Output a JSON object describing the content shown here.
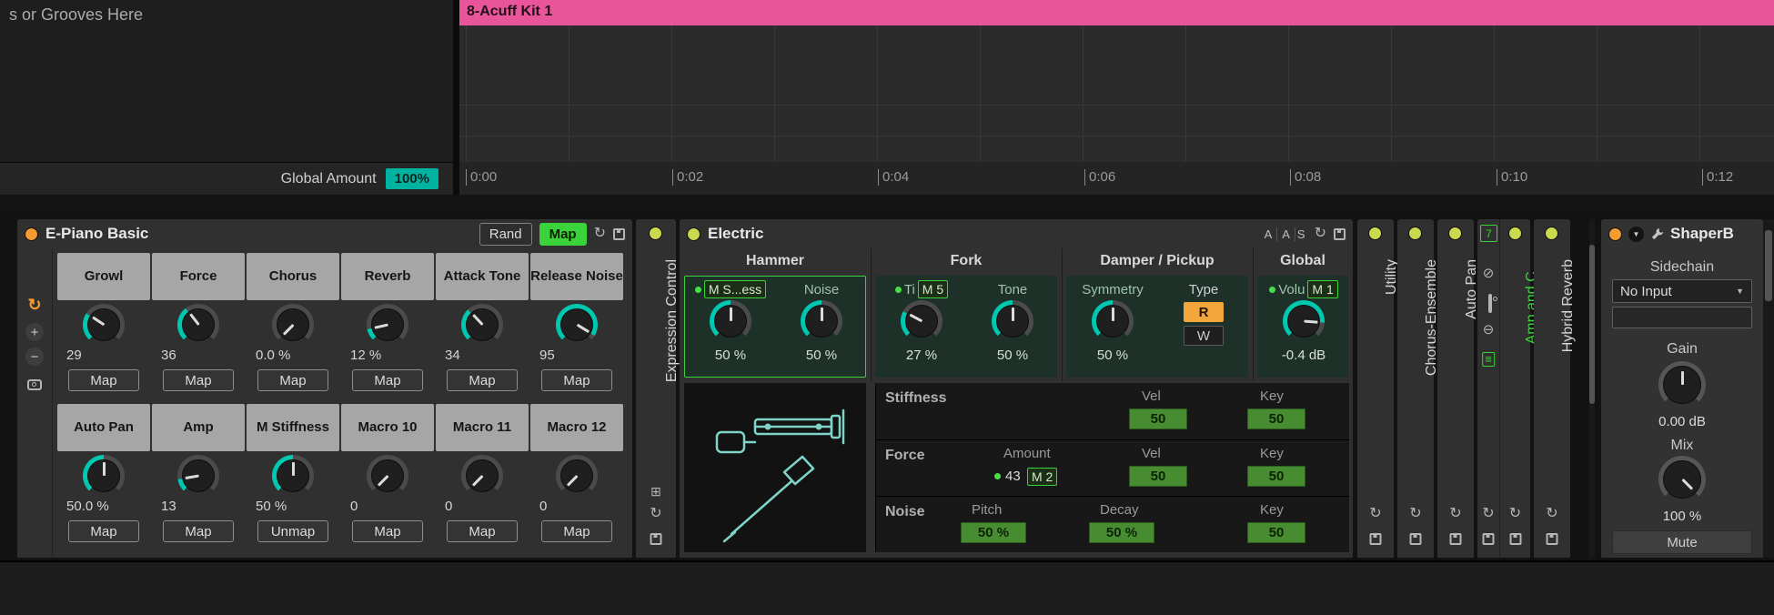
{
  "colors": {
    "teal": "#00c7b0",
    "green": "#3ad43a",
    "orange": "#f59b31",
    "pink": "#e9559b",
    "badge_teal": "#00b3a0"
  },
  "top": {
    "hint": "s or Grooves Here",
    "global_amount_label": "Global Amount",
    "global_amount_value": "100%",
    "clip_name": "8-Acuff Kit 1",
    "ticks": [
      "0:00",
      "0:02",
      "0:04",
      "0:06",
      "0:08",
      "0:10",
      "0:12"
    ]
  },
  "epiano": {
    "title": "E-Piano Basic",
    "rand": "Rand",
    "map": "Map",
    "row1": [
      {
        "name": "Growl",
        "value": "29",
        "pct": 29,
        "btn": "Map"
      },
      {
        "name": "Force",
        "value": "36",
        "pct": 36,
        "btn": "Map"
      },
      {
        "name": "Chorus",
        "value": "0.0 %",
        "pct": 0,
        "btn": "Map"
      },
      {
        "name": "Reverb",
        "value": "12 %",
        "pct": 12,
        "btn": "Map"
      },
      {
        "name": "Attack Tone",
        "value": "34",
        "pct": 34,
        "btn": "Map"
      },
      {
        "name": "Release Noise",
        "value": "95",
        "pct": 95,
        "btn": "Map"
      }
    ],
    "row2": [
      {
        "name": "Auto Pan",
        "value": "50.0 %",
        "pct": 50,
        "btn": "Map"
      },
      {
        "name": "Amp",
        "value": "13",
        "pct": 13,
        "btn": "Map"
      },
      {
        "name": "M Stiffness",
        "value": "50 %",
        "pct": 50,
        "btn": "Unmap"
      },
      {
        "name": "Macro 10",
        "value": "0",
        "pct": 0,
        "btn": "Map"
      },
      {
        "name": "Macro 11",
        "value": "0",
        "pct": 0,
        "btn": "Map"
      },
      {
        "name": "Macro 12",
        "value": "0",
        "pct": 0,
        "btn": "Map"
      }
    ]
  },
  "expression": {
    "title": "Expression Control"
  },
  "electric": {
    "title": "Electric",
    "brand": [
      "A",
      "A",
      "S"
    ],
    "sections": {
      "hammer": "Hammer",
      "fork": "Fork",
      "damper": "Damper / Pickup",
      "global": "Global"
    },
    "hammer": {
      "p1_label": "M S...ess",
      "p1_value": "50 %",
      "p1_pct": 50,
      "p2_label": "Noise",
      "p2_value": "50 %",
      "p2_pct": 50
    },
    "fork": {
      "p1_label": "Ti",
      "p1_box": "M 5",
      "p1_value": "27 %",
      "p1_pct": 27,
      "p2_label": "Tone",
      "p2_value": "50 %",
      "p2_pct": 50
    },
    "damper": {
      "p1_label": "Symmetry",
      "p1_value": "50 %",
      "p1_pct": 50,
      "type_label": "Type",
      "r": "R",
      "w": "W"
    },
    "global": {
      "label": "Volu",
      "box": "M 1",
      "value": "-0.4 dB",
      "pct": 85
    },
    "table": {
      "stiffness": {
        "name": "Stiffness",
        "vel_h": "Vel",
        "vel": "50",
        "key_h": "Key",
        "key": "50"
      },
      "force": {
        "name": "Force",
        "amount_h": "Amount",
        "amount": "43",
        "amount_box": "M 2",
        "vel_h": "Vel",
        "vel": "50",
        "key_h": "Key",
        "key": "50"
      },
      "noise": {
        "name": "Noise",
        "pitch_h": "Pitch",
        "pitch": "50 %",
        "decay_h": "Decay",
        "decay": "50 %",
        "key_h": "Key",
        "key": "50"
      }
    }
  },
  "collapsed": {
    "utility": "Utility",
    "chorus": "Chorus-Ensemble",
    "autopan": "Auto Pan",
    "amp": "Amp and C...",
    "amp_badge": "7",
    "hybrid": "Hybrid Reverb"
  },
  "shaper": {
    "title": "ShaperBo",
    "sidechain": "Sidechain",
    "input": "No Input",
    "gain_label": "Gain",
    "gain_value": "0.00 dB",
    "gain_pct": 50,
    "mix_label": "Mix",
    "mix_value": "100 %",
    "mix_pct": 100,
    "mute": "Mute"
  }
}
